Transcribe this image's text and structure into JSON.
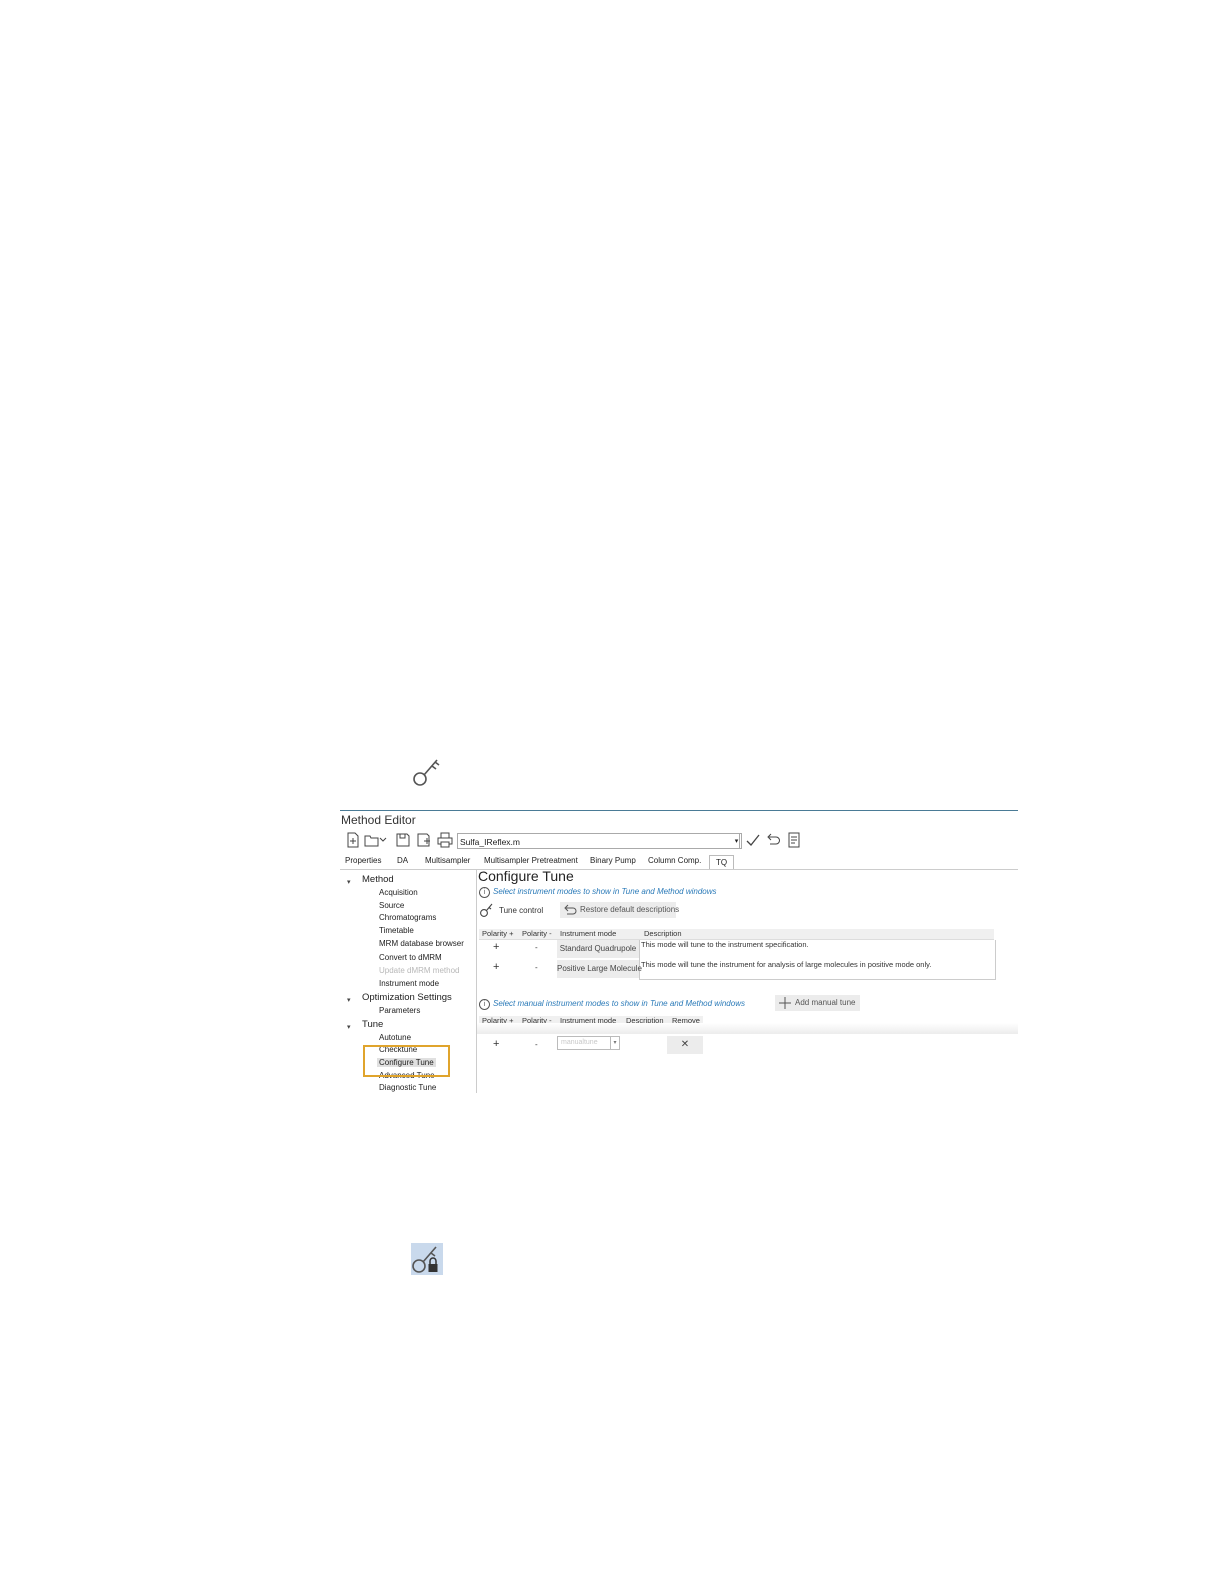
{
  "icons": {
    "top": "tune-key-icon",
    "bottom": "tune-key-lock-icon"
  },
  "editor": {
    "title": "Method Editor",
    "file_name": "Sulfa_IReflex.m",
    "tabs": [
      "Properties",
      "DA",
      "Multisampler",
      "Multisampler Pretreatment",
      "Binary Pump",
      "Column Comp.",
      "TQ"
    ],
    "active_tab": "TQ"
  },
  "nav": {
    "method": {
      "label": "Method",
      "items": [
        "Acquisition",
        "Source",
        "Chromatograms",
        "Timetable",
        "MRM database browser",
        "Convert to dMRM",
        "Update dMRM method",
        "Instrument mode"
      ]
    },
    "optimization": {
      "label": "Optimization Settings",
      "items": [
        "Parameters"
      ]
    },
    "tune": {
      "label": "Tune",
      "items": [
        "Autotune",
        "Checktune",
        "Configure Tune",
        "Advanced Tune",
        "Diagnostic Tune"
      ]
    }
  },
  "content": {
    "heading": "Configure Tune",
    "info1": "Select instrument modes to show in Tune and Method windows",
    "tune_control": "Tune control",
    "restore": "Restore default descriptions",
    "table1": {
      "headers": [
        "Polarity +",
        "Polarity -",
        "Instrument mode",
        "Description"
      ],
      "rows": [
        {
          "plus": "+",
          "minus": "-",
          "mode": "Standard Quadrupole",
          "description": "This mode will tune to the instrument specification."
        },
        {
          "plus": "+",
          "minus": "-",
          "mode": "Positive Large Molecule",
          "description": "This mode will tune the instrument for analysis of large molecules in positive mode only."
        }
      ]
    },
    "info2": "Select manual instrument modes to show in Tune and Method windows",
    "add_manual": "Add manual tune",
    "table2": {
      "headers": [
        "Polarity +",
        "Polarity -",
        "Instrument mode",
        "Description",
        "Remove"
      ],
      "row": {
        "plus": "+",
        "minus": "-",
        "mode_placeholder": "manualtune",
        "remove": "✕"
      }
    }
  }
}
